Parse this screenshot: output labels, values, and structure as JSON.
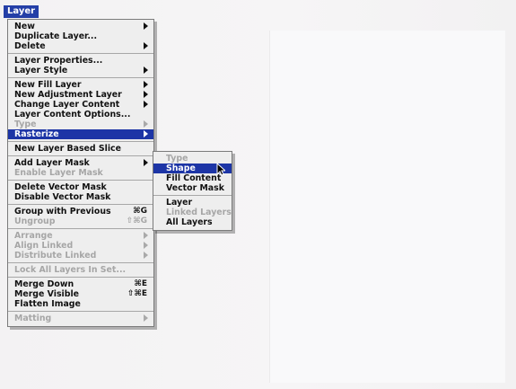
{
  "menu_title": "Layer",
  "menu": {
    "new_label": "New",
    "duplicate_label": "Duplicate Layer...",
    "delete_label": "Delete",
    "layer_properties_label": "Layer Properties...",
    "layer_style_label": "Layer Style",
    "new_fill_layer_label": "New Fill Layer",
    "new_adjustment_layer_label": "New Adjustment Layer",
    "change_layer_content_label": "Change Layer Content",
    "layer_content_options_label": "Layer Content Options...",
    "type_label": "Type",
    "rasterize_label": "Rasterize",
    "new_layer_based_slice_label": "New Layer Based Slice",
    "add_layer_mask_label": "Add Layer Mask",
    "enable_layer_mask_label": "Enable Layer Mask",
    "delete_vector_mask_label": "Delete Vector Mask",
    "disable_vector_mask_label": "Disable Vector Mask",
    "group_with_previous_label": "Group with Previous",
    "group_with_previous_shortcut": "⌘G",
    "ungroup_label": "Ungroup",
    "ungroup_shortcut": "⇧⌘G",
    "arrange_label": "Arrange",
    "align_linked_label": "Align Linked",
    "distribute_linked_label": "Distribute Linked",
    "lock_all_layers_label": "Lock All Layers In Set...",
    "merge_down_label": "Merge Down",
    "merge_down_shortcut": "⌘E",
    "merge_visible_label": "Merge Visible",
    "merge_visible_shortcut": "⇧⌘E",
    "flatten_image_label": "Flatten Image",
    "matting_label": "Matting"
  },
  "submenu": {
    "type_label": "Type",
    "shape_label": "Shape",
    "fill_content_label": "Fill Content",
    "vector_mask_label": "Vector Mask",
    "layer_label": "Layer",
    "linked_layers_label": "Linked Layers",
    "all_layers_label": "All Layers"
  },
  "icons": {
    "submenu_arrow": "chevron-right-icon",
    "cursor": "arrow-cursor-icon"
  },
  "colors": {
    "menu_title_bg": "#243fa7",
    "highlight": "#1d35a6",
    "menu_bg": "#eeeeee",
    "disabled_text": "#a6a6a6"
  }
}
